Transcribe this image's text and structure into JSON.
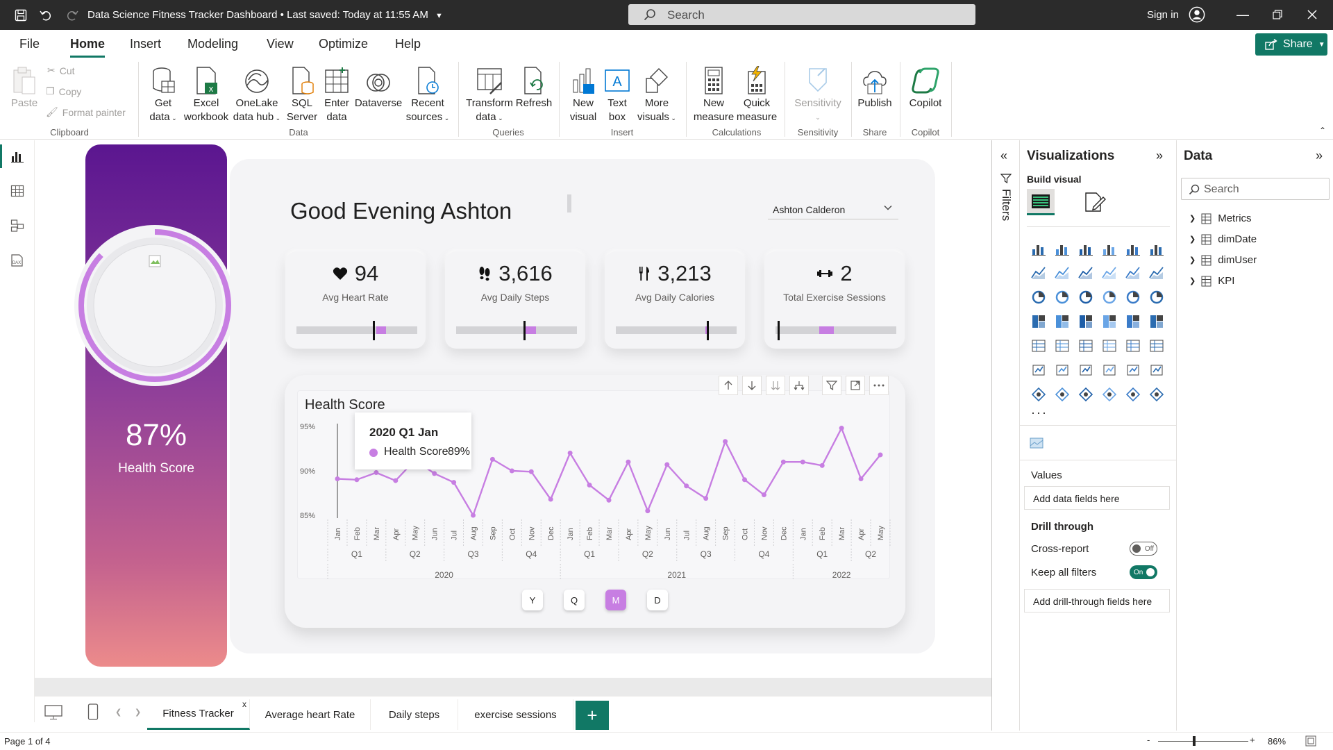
{
  "titlebar": {
    "title": "Data Science Fitness Tracker Dashboard",
    "saved": "Last saved: Today at 11:55 AM",
    "search_placeholder": "Search",
    "signin": "Sign in"
  },
  "menu": {
    "items": [
      "File",
      "Home",
      "Insert",
      "Modeling",
      "View",
      "Optimize",
      "Help"
    ],
    "active": "Home",
    "share": "Share"
  },
  "ribbon": {
    "clipboard": {
      "paste": "Paste",
      "cut": "Cut",
      "copy": "Copy",
      "format_painter": "Format painter",
      "group": "Clipboard"
    },
    "data": {
      "get_data": [
        "Get",
        "data"
      ],
      "excel": [
        "Excel",
        "workbook"
      ],
      "onelake": [
        "OneLake",
        "data hub"
      ],
      "sql": [
        "SQL",
        "Server"
      ],
      "enter": [
        "Enter",
        "data"
      ],
      "dataverse": "Dataverse",
      "recent": [
        "Recent",
        "sources"
      ],
      "group": "Data"
    },
    "queries": {
      "transform": [
        "Transform",
        "data"
      ],
      "refresh": "Refresh",
      "group": "Queries"
    },
    "insert": {
      "new_visual": [
        "New",
        "visual"
      ],
      "text_box": [
        "Text",
        "box"
      ],
      "more_visuals": [
        "More",
        "visuals"
      ],
      "group": "Insert"
    },
    "calculations": {
      "new_measure": [
        "New",
        "measure"
      ],
      "quick_measure": [
        "Quick",
        "measure"
      ],
      "group": "Calculations"
    },
    "sensitivity": {
      "label": "Sensitivity",
      "group": "Sensitivity"
    },
    "share": {
      "publish": "Publish",
      "group": "Share"
    },
    "copilot": {
      "label": "Copilot",
      "group": "Copilot"
    }
  },
  "report": {
    "greeting": "Good Evening Ashton",
    "user_selected": "Ashton Calderon",
    "health_score_pct": "87%",
    "health_score_label": "Health Score",
    "health_score_value": 0.87,
    "kpis": [
      {
        "value": "94",
        "label": "Avg Heart Rate",
        "icon": "heart-icon",
        "fill_start": 0.66,
        "fill_end": 0.74,
        "marker": 0.63
      },
      {
        "value": "3,616",
        "label": "Avg Daily Steps",
        "icon": "footsteps-icon",
        "fill_start": 0.57,
        "fill_end": 0.66,
        "marker": 0.56
      },
      {
        "value": "3,213",
        "label": "Avg Daily Calories",
        "icon": "cutlery-icon",
        "fill_start": 0.74,
        "fill_end": 0.77,
        "marker": 0.75
      },
      {
        "value": "2",
        "label": "Total Exercise Sessions",
        "icon": "dumbbell-icon",
        "fill_start": 0.36,
        "fill_end": 0.48,
        "marker": 0.02
      }
    ],
    "granularity": [
      "Y",
      "Q",
      "M",
      "D"
    ],
    "granularity_active": "M",
    "tooltip": {
      "title": "2020 Q1 Jan",
      "label": "Health Score",
      "value": "89%"
    }
  },
  "chart_data": {
    "type": "line",
    "title": "Health Score",
    "xlabel": "",
    "ylabel": "",
    "ylim": [
      85,
      95
    ],
    "yticks": [
      "85%",
      "90%",
      "95%"
    ],
    "grid": false,
    "months": [
      "Jan",
      "Feb",
      "Mar",
      "Apr",
      "May",
      "Jun",
      "Jul",
      "Aug",
      "Sep",
      "Oct",
      "Nov",
      "Dec",
      "Jan",
      "Feb",
      "Mar",
      "Apr",
      "May",
      "Jun",
      "Jul",
      "Aug",
      "Sep",
      "Oct",
      "Nov",
      "Dec",
      "Jan",
      "Feb",
      "Mar",
      "Apr",
      "May"
    ],
    "quarters": [
      "Q1",
      "Q2",
      "Q3",
      "Q4",
      "Q1",
      "Q2",
      "Q3",
      "Q4",
      "Q1",
      "Q2"
    ],
    "years": [
      "2020",
      "2021",
      "2022"
    ],
    "series": [
      {
        "name": "Health Score",
        "color": "#c77ee2",
        "values": [
          89.1,
          89.0,
          89.8,
          88.9,
          91.2,
          89.7,
          88.7,
          85.0,
          91.3,
          90.0,
          89.9,
          86.8,
          92.0,
          88.4,
          86.7,
          91.0,
          85.5,
          90.7,
          88.3,
          86.9,
          93.3,
          89.0,
          87.3,
          91.0,
          91.0,
          90.6,
          94.8,
          89.1,
          91.8
        ]
      }
    ]
  },
  "panes": {
    "filters": "Filters",
    "visualizations": "Visualizations",
    "build_visual": "Build visual",
    "values": "Values",
    "add_data_fields": "Add data fields here",
    "drill_through": "Drill through",
    "cross_report": "Cross-report",
    "cross_report_state": "Off",
    "keep_all_filters": "Keep all filters",
    "keep_all_filters_state": "On",
    "add_drill_fields": "Add drill-through fields here",
    "data": "Data",
    "data_search": "Search",
    "tables": [
      "Metrics",
      "dimDate",
      "dimUser",
      "KPI"
    ]
  },
  "tabs": [
    "Fitness Tracker",
    "Average heart Rate",
    "Daily steps",
    "exercise sessions"
  ],
  "active_tab": "Fitness Tracker",
  "status": {
    "page": "Page 1 of 4",
    "zoom": "86%"
  },
  "colors": {
    "accent": "#117865",
    "purple": "#c77ee2",
    "panel_top": "#5b1690",
    "panel_bottom": "#ec8b8b"
  }
}
